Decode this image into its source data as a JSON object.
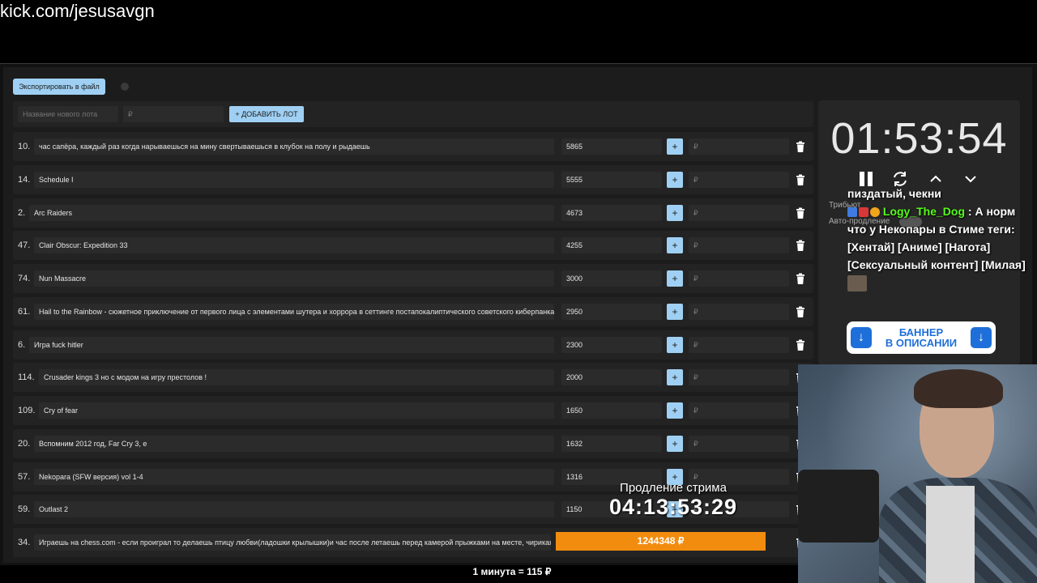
{
  "stream_url": "kick.com/jesusavgn",
  "toolbar": {
    "export_label": "Экспортировать в файл"
  },
  "new_lot": {
    "name_placeholder": "Название нового лота",
    "price_placeholder": "₽",
    "add_label": "+ ДОБАВИТЬ ЛОТ"
  },
  "lots": [
    {
      "num": "10.",
      "title": "час сапёра, каждый раз когда нарываешься на мину свертываешься в клубок на полу и рыдаешь",
      "amount": "5865"
    },
    {
      "num": "14.",
      "title": "Schedule I",
      "amount": "5555"
    },
    {
      "num": "2.",
      "title": "Arc Raiders",
      "amount": "4673"
    },
    {
      "num": "47.",
      "title": "Clair Obscur: Expedition 33",
      "amount": "4255"
    },
    {
      "num": "74.",
      "title": "Nun Massacre",
      "amount": "3000"
    },
    {
      "num": "61.",
      "title": "Hail to the Rainbow - сюжетное приключение от первого лица с элементами шутера и хоррора в сеттинге постапокалиптического советского киберпанка",
      "amount": "2950"
    },
    {
      "num": "6.",
      "title": "Игра fuck hitler",
      "amount": "2300"
    },
    {
      "num": "114.",
      "title": "Crusader kings 3 но с модом на игру престолов !",
      "amount": "2000"
    },
    {
      "num": "109.",
      "title": "Cry of fear",
      "amount": "1650"
    },
    {
      "num": "20.",
      "title": "Вспомним 2012 год, Far Cry 3, е",
      "amount": "1632"
    },
    {
      "num": "57.",
      "title": "Nekopara (SFW версия) vol 1-4",
      "amount": "1316"
    },
    {
      "num": "59.",
      "title": "Outlast 2",
      "amount": "1150"
    },
    {
      "num": "34.",
      "title": "Играешь на chess.com - если проиграл то делаешь птицу любви(ладошки крылышки)и час после летаешь перед камерой прыжками на месте, чирикая:",
      "amount": ""
    }
  ],
  "row_controls": {
    "plus": "+",
    "rub_placeholder": "₽"
  },
  "total": "1244348 ₽",
  "timer": {
    "value": "01:53:54",
    "tribute_label": "Трибьют",
    "auto_label": "Авто-продление"
  },
  "chat": {
    "line1": "пиздатый, чекни",
    "username": "Logy_The_Dog",
    "separator": " : ",
    "message": "А норм что у Некопары в Стиме теги: [Хентай] [Аниме] [Нагота] [Сексуальный контент] [Милая]"
  },
  "banner": {
    "line1": "БАННЕР",
    "line2": "В ОПИСАНИИ"
  },
  "extension": {
    "title": "Продление стрима",
    "time": "04:13:53:29"
  },
  "rate": "1 минута = 115 ₽",
  "colors": {
    "accent": "#9fd0f3",
    "total_bar": "#f28c0f",
    "chat_user": "#53fc18",
    "banner_blue": "#1e6fd9"
  }
}
